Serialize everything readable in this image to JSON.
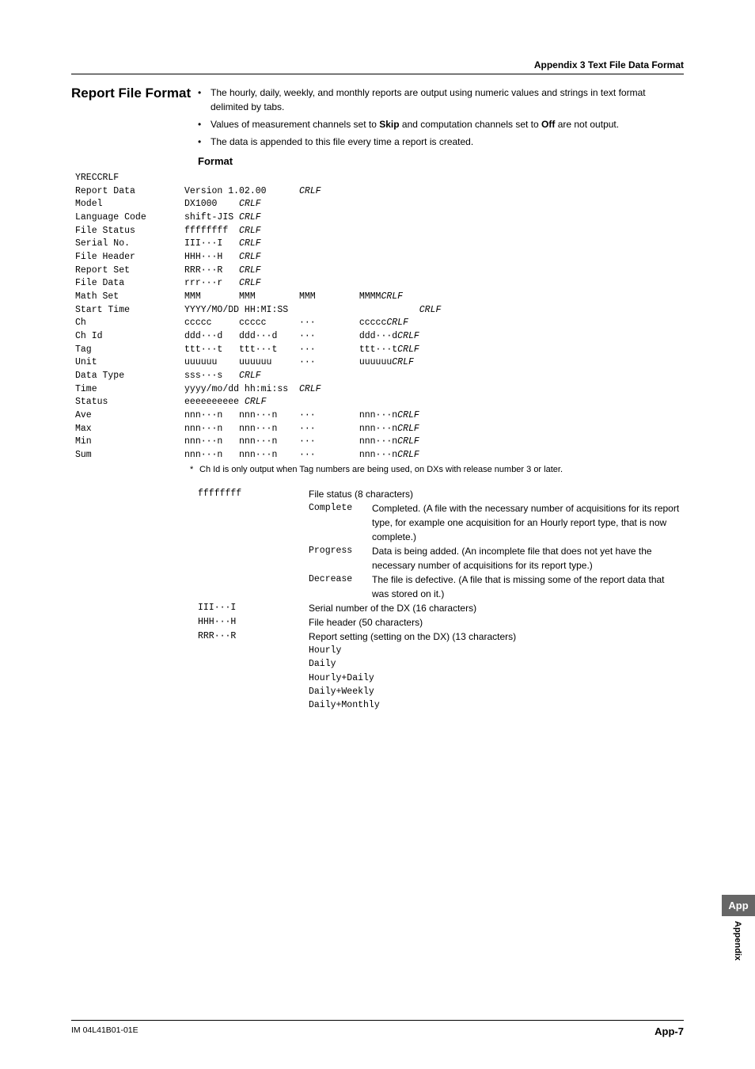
{
  "header": {
    "appendix": "Appendix 3  Text File Data Format"
  },
  "title": "Report File Format",
  "bullets": [
    {
      "text_pre": "The hourly, daily, weekly, and monthly reports are output using numeric values and strings in text format delimited by tabs."
    },
    {
      "text_pre": "Values of measurement channels set to ",
      "bold1": "Skip",
      "mid": " and computation channels set to ",
      "bold2": "Off",
      "text_post": " are not output."
    },
    {
      "text_pre": "The data is appended to this file every time a report is created."
    }
  ],
  "format_heading": "Format",
  "fmt": {
    "l1": "YRECCRLF",
    "l2a": "Report Data         Version 1.02.00      ",
    "l2c": "CRLF",
    "l3a": "Model               DX1000    ",
    "l3c": "CRLF",
    "l4a": "Language Code       shift-JIS ",
    "l4c": "CRLF",
    "l5a": "File Status         ffffffff  ",
    "l5c": "CRLF",
    "l6a": "Serial No.          III···I   ",
    "l6c": "CRLF",
    "l7a": "File Header         HHH···H   ",
    "l7c": "CRLF",
    "l8a": "Report Set          RRR···R   ",
    "l8c": "CRLF",
    "l9a": "File Data           rrr···r   ",
    "l9c": "CRLF",
    "l10a": "Math Set            MMM       MMM        MMM        MMMM",
    "l10c": "CRLF",
    "l11a": "Start Time          YYYY/MO/DD HH:MI:SS                        ",
    "l11c": "CRLF",
    "l12a": "Ch                  ccccc     ccccc      ···        ccccc",
    "l12c": "CRLF",
    "l13a": "Ch Id               ddd···d   ddd···d    ···        ddd···d",
    "l13c": "CRLF",
    "l14a": "Tag                 ttt···t   ttt···t    ···        ttt···t",
    "l14c": "CRLF",
    "l15a": "Unit                uuuuuu    uuuuuu     ···        uuuuuu",
    "l15c": "CRLF",
    "l16a": "Data Type           sss···s   ",
    "l16c": "CRLF",
    "l17a": "Time                yyyy/mo/dd hh:mi:ss  ",
    "l17c": "CRLF",
    "l18a": "Status              eeeeeeeeee ",
    "l18c": "CRLF",
    "l19a": "Ave                 nnn···n   nnn···n    ···        nnn···n",
    "l19c": "CRLF",
    "l20a": "Max                 nnn···n   nnn···n    ···        nnn···n",
    "l20c": "CRLF",
    "l21a": "Min                 nnn···n   nnn···n    ···        nnn···n",
    "l21c": "CRLF",
    "l22a": "Sum                 nnn···n   nnn···n    ···        nnn···n",
    "l22c": "CRLF"
  },
  "footnote": {
    "star": "*",
    "text": "Ch Id is only output when Tag numbers are being used, on DXs with release number 3 or later."
  },
  "desc": [
    {
      "key": "ffffffff",
      "heading": "File status (8 characters)",
      "subs": [
        {
          "k": "Complete",
          "v": "Completed. (A file with the necessary number of acquisitions for its report type, for example one acquisition for an Hourly report type, that is now complete.)"
        },
        {
          "k": "Progress",
          "v": "Data is being added. (An incomplete file that does not yet have the necessary number of acquisitions for its report type.)"
        },
        {
          "k": "Decrease",
          "v": "The file is defective. (A file that is missing some of the report data that was stored on it.)"
        }
      ]
    },
    {
      "key": "III···I",
      "heading": "Serial number of the DX (16 characters)"
    },
    {
      "key": "HHH···H",
      "heading": "File header (50 characters)"
    },
    {
      "key": "RRR···R",
      "heading": "Report setting (setting on the DX) (13 characters)",
      "list": [
        "Hourly",
        "Daily",
        "Hourly+Daily",
        "Daily+Weekly",
        "Daily+Monthly"
      ]
    }
  ],
  "sidetab": {
    "box": "App",
    "text": "Appendix"
  },
  "footer": {
    "left": "IM 04L41B01-01E",
    "right": "App-7"
  }
}
